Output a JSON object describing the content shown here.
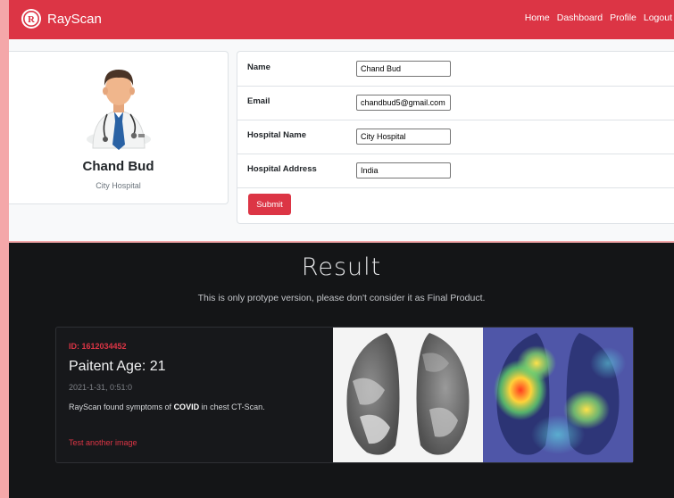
{
  "navbar": {
    "brand": "RayScan",
    "links": [
      "Home",
      "Dashboard",
      "Profile",
      "Logout"
    ]
  },
  "profile": {
    "name": "Chand Bud",
    "hospital": "City Hospital"
  },
  "form": {
    "fields": [
      {
        "label": "Name",
        "value": "Chand Bud"
      },
      {
        "label": "Email",
        "value": "chandbud5@gmail.com"
      },
      {
        "label": "Hospital Name",
        "value": "City Hospital"
      },
      {
        "label": "Hospital Address",
        "value": "India"
      }
    ],
    "submit_label": "Submit"
  },
  "result": {
    "title": "Result",
    "subtitle": "This is only protype version, please don't consider it as Final Product.",
    "card": {
      "id_text": "ID: 1612034452",
      "age_text": "Paitent Age: 21",
      "date_text": "2021-1-31, 0:51:0",
      "finding_prefix": "RayScan found symptoms of ",
      "finding_bold": "COVID",
      "finding_suffix": " in chest CT-Scan.",
      "link_text": "Test another image"
    }
  },
  "colors": {
    "accent": "#dc3545",
    "page_background": "#f4a7a9",
    "result_background": "#141517"
  },
  "icons": {
    "brand_logo": "rayscan-logo",
    "avatar": "doctor-avatar"
  }
}
